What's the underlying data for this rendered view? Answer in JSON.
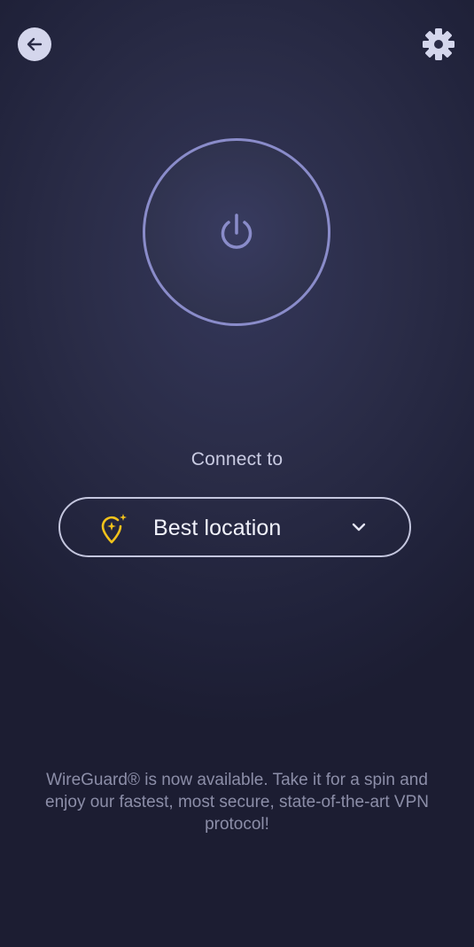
{
  "header": {
    "back_icon": "arrow-left-icon",
    "settings_icon": "gear-icon"
  },
  "power": {
    "icon": "power-icon",
    "ring_color": "#8a8cca"
  },
  "connect": {
    "label": "Connect to",
    "location": {
      "icon": "location-pin-sparkle-icon",
      "icon_color": "#f2c21b",
      "value": "Best location",
      "dropdown_icon": "chevron-down-icon"
    }
  },
  "promo": {
    "text": "WireGuard® is now available. Take it for a spin and enjoy our fastest, most secure, state-of-the-art VPN protocol!"
  }
}
